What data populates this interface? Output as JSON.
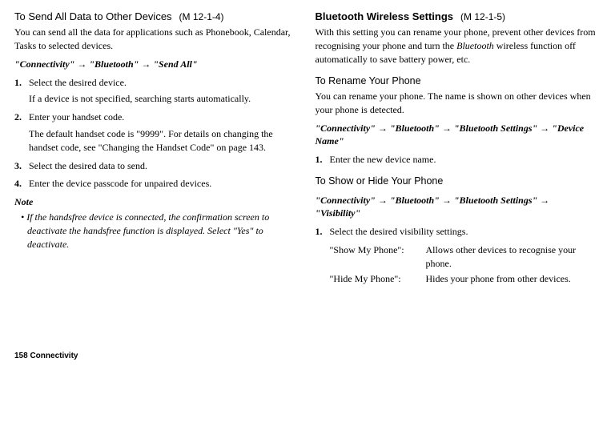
{
  "left": {
    "title": "To Send All Data to Other Devices",
    "menuCode": "(M 12-1-4)",
    "intro": "You can send all the data for applications such as Phonebook, Calendar, Tasks to selected devices.",
    "navpath": "\"Connectivity\" → \"Bluetooth\" → \"Send All\"",
    "steps": [
      {
        "num": "1.",
        "text": "Select the desired device.",
        "sub": "If a device is not specified, searching starts automatically."
      },
      {
        "num": "2.",
        "text": "Enter your handset code.",
        "sub": "The default handset code is \"9999\". For details on changing the handset code, see \"Changing the Handset Code\" on page 143."
      },
      {
        "num": "3.",
        "text": "Select the desired data to send."
      },
      {
        "num": "4.",
        "text": "Enter the device passcode for unpaired devices."
      }
    ],
    "noteHead": "Note",
    "noteBody": "• If the handsfree device is connected, the confirmation screen to deactivate the handsfree function is displayed. Select \"Yes\" to deactivate."
  },
  "right": {
    "title": "Bluetooth Wireless Settings",
    "menuCode": "(M 12-1-5)",
    "intro": "With this setting you can rename your phone, prevent other devices from recognising your phone and turn the Bluetooth wireless function off automatically to save battery power, etc.",
    "bluetoothItalic": "Bluetooth",
    "sub1Title": "To Rename Your Phone",
    "sub1Body": "You can rename your phone. The name is shown on other devices when your phone is detected.",
    "sub1Nav": "\"Connectivity\" → \"Bluetooth\" → \"Bluetooth Settings\" → \"Device Name\"",
    "sub1Step": {
      "num": "1.",
      "text": "Enter the new device name."
    },
    "sub2Title": "To Show or Hide Your Phone",
    "sub2Nav": "\"Connectivity\" → \"Bluetooth\" → \"Bluetooth Settings\" → \"Visibility\"",
    "sub2Step": {
      "num": "1.",
      "text": "Select the desired visibility settings."
    },
    "defs": [
      {
        "label": "\"Show My Phone\":",
        "desc": "Allows other devices to recognise your phone."
      },
      {
        "label": "\"Hide My Phone\":",
        "desc": "Hides your phone from other devices."
      }
    ]
  },
  "footer": "158   Connectivity"
}
